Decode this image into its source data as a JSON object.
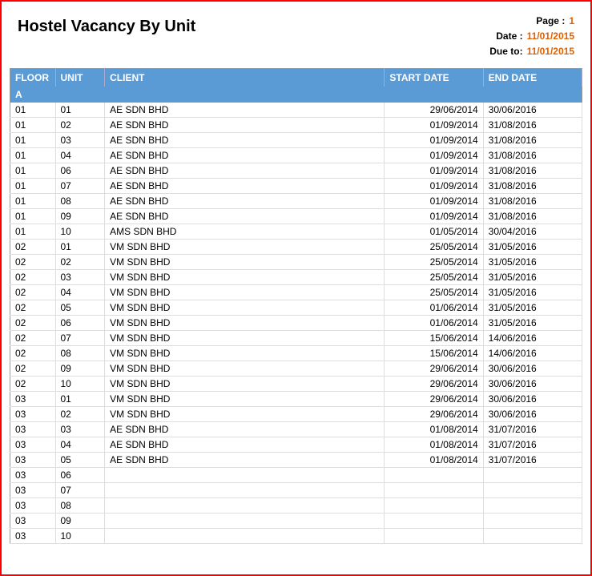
{
  "header": {
    "title": "Hostel Vacancy By Unit",
    "page_label": "Page :",
    "page_value": "1",
    "date_label": "Date :",
    "date_value": "11/01/2015",
    "due_label": "Due to:",
    "due_value": "11/01/2015"
  },
  "columns": {
    "floor": "FLOOR",
    "unit": "UNIT",
    "client": "CLIENT",
    "start_date": "START DATE",
    "end_date": "END DATE"
  },
  "sections": [
    {
      "label": "A",
      "rows": [
        {
          "floor": "01",
          "unit": "01",
          "client": "AE SDN BHD",
          "start_date": "29/06/2014",
          "end_date": "30/06/2016"
        },
        {
          "floor": "01",
          "unit": "02",
          "client": "AE SDN BHD",
          "start_date": "01/09/2014",
          "end_date": "31/08/2016"
        },
        {
          "floor": "01",
          "unit": "03",
          "client": "AE SDN BHD",
          "start_date": "01/09/2014",
          "end_date": "31/08/2016"
        },
        {
          "floor": "01",
          "unit": "04",
          "client": "AE SDN BHD",
          "start_date": "01/09/2014",
          "end_date": "31/08/2016"
        },
        {
          "floor": "01",
          "unit": "06",
          "client": "AE SDN BHD",
          "start_date": "01/09/2014",
          "end_date": "31/08/2016"
        },
        {
          "floor": "01",
          "unit": "07",
          "client": "AE SDN BHD",
          "start_date": "01/09/2014",
          "end_date": "31/08/2016"
        },
        {
          "floor": "01",
          "unit": "08",
          "client": "AE SDN BHD",
          "start_date": "01/09/2014",
          "end_date": "31/08/2016"
        },
        {
          "floor": "01",
          "unit": "09",
          "client": "AE SDN BHD",
          "start_date": "01/09/2014",
          "end_date": "31/08/2016"
        },
        {
          "floor": "01",
          "unit": "10",
          "client": "AMS SDN BHD",
          "start_date": "01/05/2014",
          "end_date": "30/04/2016"
        },
        {
          "floor": "02",
          "unit": "01",
          "client": "VM SDN BHD",
          "start_date": "25/05/2014",
          "end_date": "31/05/2016"
        },
        {
          "floor": "02",
          "unit": "02",
          "client": "VM SDN BHD",
          "start_date": "25/05/2014",
          "end_date": "31/05/2016"
        },
        {
          "floor": "02",
          "unit": "03",
          "client": "VM SDN BHD",
          "start_date": "25/05/2014",
          "end_date": "31/05/2016"
        },
        {
          "floor": "02",
          "unit": "04",
          "client": "VM SDN BHD",
          "start_date": "25/05/2014",
          "end_date": "31/05/2016"
        },
        {
          "floor": "02",
          "unit": "05",
          "client": "VM SDN BHD",
          "start_date": "01/06/2014",
          "end_date": "31/05/2016"
        },
        {
          "floor": "02",
          "unit": "06",
          "client": "VM SDN BHD",
          "start_date": "01/06/2014",
          "end_date": "31/05/2016"
        },
        {
          "floor": "02",
          "unit": "07",
          "client": "VM SDN BHD",
          "start_date": "15/06/2014",
          "end_date": "14/06/2016"
        },
        {
          "floor": "02",
          "unit": "08",
          "client": "VM SDN BHD",
          "start_date": "15/06/2014",
          "end_date": "14/06/2016"
        },
        {
          "floor": "02",
          "unit": "09",
          "client": "VM SDN BHD",
          "start_date": "29/06/2014",
          "end_date": "30/06/2016"
        },
        {
          "floor": "02",
          "unit": "10",
          "client": "VM SDN BHD",
          "start_date": "29/06/2014",
          "end_date": "30/06/2016"
        },
        {
          "floor": "03",
          "unit": "01",
          "client": "VM SDN BHD",
          "start_date": "29/06/2014",
          "end_date": "30/06/2016"
        },
        {
          "floor": "03",
          "unit": "02",
          "client": "VM SDN BHD",
          "start_date": "29/06/2014",
          "end_date": "30/06/2016"
        },
        {
          "floor": "03",
          "unit": "03",
          "client": "AE SDN BHD",
          "start_date": "01/08/2014",
          "end_date": "31/07/2016"
        },
        {
          "floor": "03",
          "unit": "04",
          "client": "AE SDN BHD",
          "start_date": "01/08/2014",
          "end_date": "31/07/2016"
        },
        {
          "floor": "03",
          "unit": "05",
          "client": "AE SDN BHD",
          "start_date": "01/08/2014",
          "end_date": "31/07/2016"
        },
        {
          "floor": "03",
          "unit": "06",
          "client": "",
          "start_date": "",
          "end_date": ""
        },
        {
          "floor": "03",
          "unit": "07",
          "client": "",
          "start_date": "",
          "end_date": ""
        },
        {
          "floor": "03",
          "unit": "08",
          "client": "",
          "start_date": "",
          "end_date": ""
        },
        {
          "floor": "03",
          "unit": "09",
          "client": "",
          "start_date": "",
          "end_date": ""
        },
        {
          "floor": "03",
          "unit": "10",
          "client": "",
          "start_date": "",
          "end_date": ""
        }
      ]
    }
  ]
}
